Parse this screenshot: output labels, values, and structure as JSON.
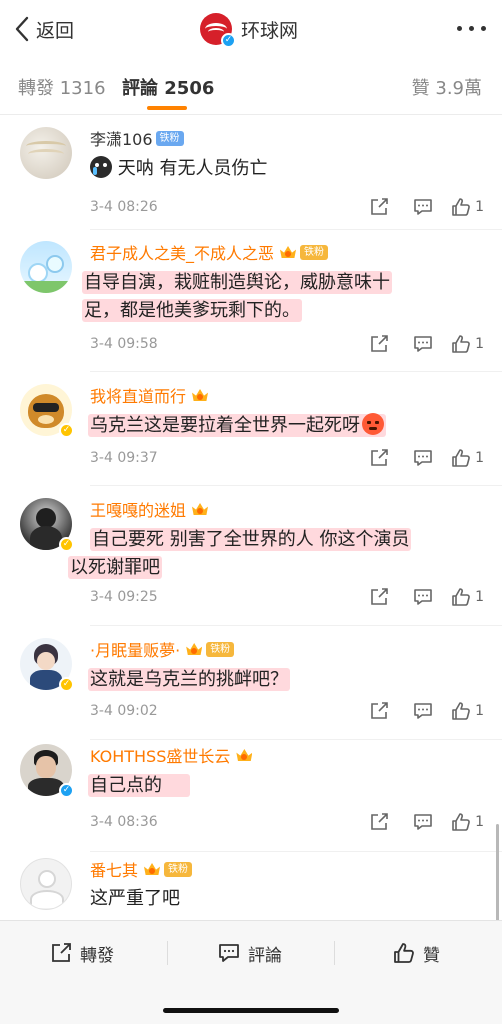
{
  "header": {
    "back_label": "返回",
    "account_name": "环球网",
    "brand_color": "#d6202a"
  },
  "tabs": [
    {
      "label": "轉發 1316"
    },
    {
      "label": "評論 2506",
      "active": true
    },
    {
      "label": "贊 3.9萬"
    }
  ],
  "comments": [
    {
      "name": "李潇106",
      "badge": "铁粉",
      "text": "天呐 有无人员伤亡",
      "time": "3-4 08:26",
      "likes": "1"
    },
    {
      "name": "君子成人之美_不成人之恶",
      "badge": "铁粉",
      "text_lines": [
        "自导自演，栽赃制造舆论，威胁意味十",
        "足，都是他美爹玩剩下的。"
      ],
      "time": "3-4 09:58",
      "likes": "1"
    },
    {
      "name": "我将直道而行",
      "text": "乌克兰这是要拉着全世界一起死呀",
      "time": "3-4 09:37",
      "likes": "1"
    },
    {
      "name": "王嘎嘎的迷姐",
      "text_lines": [
        "自己要死 别害了全世界的人  你这个演员",
        "以死谢罪吧"
      ],
      "time": "3-4 09:25",
      "likes": "1"
    },
    {
      "name": "·月眠量贩夢·",
      "badge": "铁粉",
      "text": "这就是乌克兰的挑衅吧？",
      "time": "3-4 09:02",
      "likes": "1"
    },
    {
      "name": "KOHTHSS盛世长云",
      "text": "自己点的",
      "time": "3-4 08:36",
      "likes": "1"
    },
    {
      "name": "番七其",
      "badge": "铁粉",
      "text": "这严重了吧"
    }
  ],
  "bottom_bar": {
    "repost_label": "轉發",
    "comment_label": "評論",
    "like_label": "贊"
  },
  "icons": [
    "back-chevron-icon",
    "more-icon",
    "crown-icon",
    "verified-icon",
    "share-icon",
    "comment-icon",
    "like-icon",
    "angry-emoji-icon",
    "teary-emoji-icon"
  ],
  "colors": {
    "accent": "#ff8200",
    "username": "#ff7a00",
    "highlight": "#ffaab4"
  }
}
